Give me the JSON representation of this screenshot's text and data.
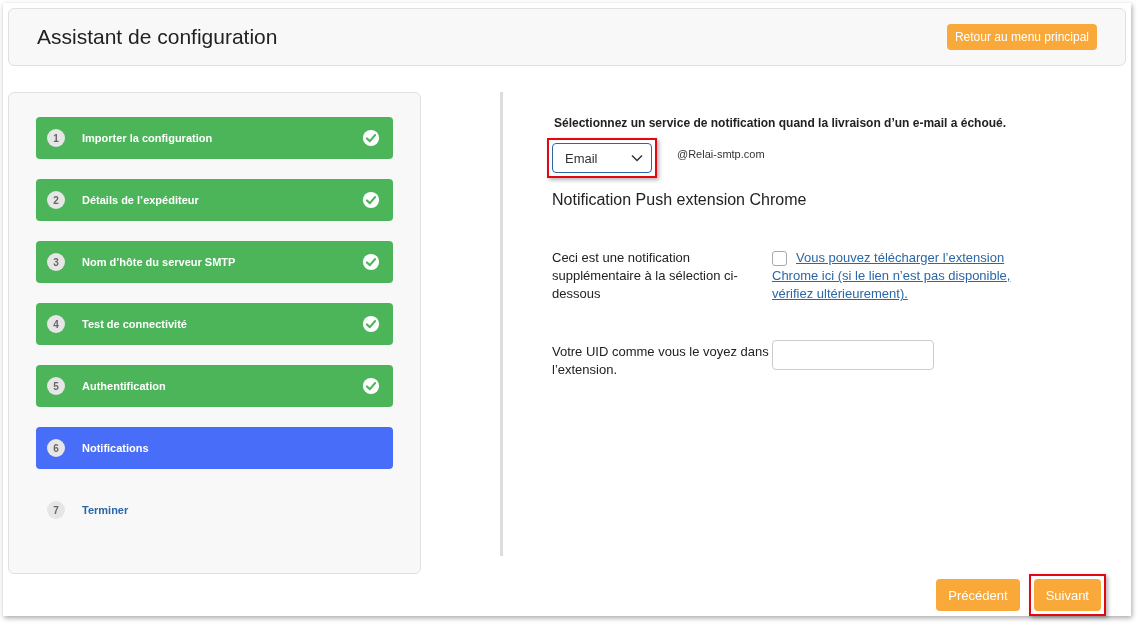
{
  "header": {
    "title": "Assistant de configuration",
    "back_button": "Retour au menu principal"
  },
  "steps": [
    {
      "number": "1",
      "label": "Importer la configuration",
      "completed": true,
      "selected": false
    },
    {
      "number": "2",
      "label": "Détails de l’expéditeur",
      "completed": true,
      "selected": false
    },
    {
      "number": "3",
      "label": "Nom d’hôte du serveur SMTP",
      "completed": true,
      "selected": false
    },
    {
      "number": "4",
      "label": "Test de connectivité",
      "completed": true,
      "selected": false
    },
    {
      "number": "5",
      "label": "Authentification",
      "completed": true,
      "selected": false
    },
    {
      "number": "6",
      "label": "Notifications",
      "completed": false,
      "selected": true
    },
    {
      "number": "7",
      "label": "Terminer",
      "completed": false,
      "selected": false
    }
  ],
  "form": {
    "prompt": "Sélectionnez un service de notification quand la livraison d’un e-mail a échoué.",
    "service_select": {
      "value": "Email",
      "highlighted": true
    },
    "sender_domain": "@Relai-smtp.com",
    "section_title": "Notification Push extension Chrome",
    "extension_row": {
      "label": "Ceci est une notification supplémentaire à la sélection ci-dessous",
      "checked": false,
      "link": "Vous pouvez télécharger l’extension Chrome ici (si le lien n’est pas disponible, vérifiez ultérieurement)."
    },
    "uid_row": {
      "label": "Votre UID comme vous le voyez dans l’extension."
    }
  },
  "footer": {
    "previous_button": {
      "label": "Précédent",
      "highlighted": false
    },
    "next_button": {
      "label": "Suivant",
      "highlighted": true
    }
  }
}
